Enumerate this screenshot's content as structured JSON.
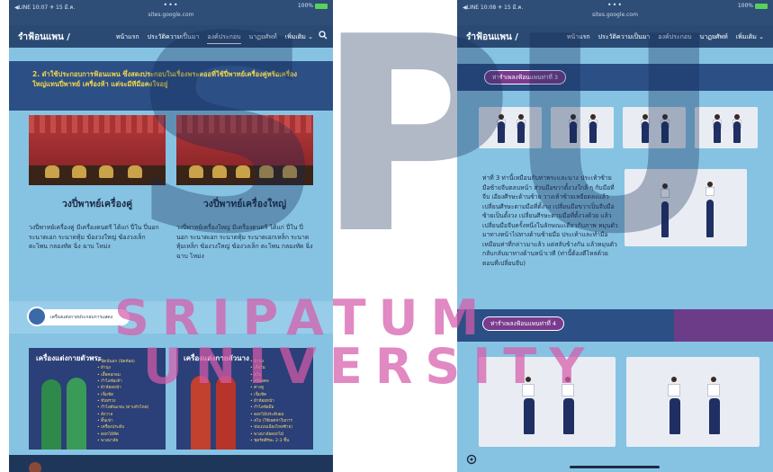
{
  "left": {
    "status": {
      "time": "◀LINE 10:07 ✈ 15 มี.ค.",
      "dots": "•••",
      "url": "sites.google.com",
      "battery": "100%"
    },
    "nav": {
      "site_title": "รำฟ้อนแพน /",
      "items": [
        "หน้าแรก",
        "ประวัติความเป็นมา",
        "องค์ประกอบ",
        "นาฏยศัพท์",
        "เพิ่มเติม ⌄"
      ],
      "active_index": 2
    },
    "section_text": "2. ดำใช้ประกอบการฟ้อนแพน ซึ่งสดงประกอบในเรื่องพระลออที่ใช้ปี่พาทย์เครื่องคู่หรือเครื่องใหญ่แทนปี่พาทย์ เครื่องห้า แต่จะมีทีมือคงใจอยู่",
    "ensembles": [
      {
        "title": "วงปี่พาทย์เครื่องคู่",
        "desc": "วงปี่พาทย์เครื่องคู่ มีเครื่องดนตรี ได้แก่ ปี่ใน ปี่นอก ระนาดเอก ระนาดทุ้ม ฆ้องวงใหญ่ ฆ้องวงเล็ก ตะโพน กลองทัด ฉิ่ง ฉาบ โหม่ง"
      },
      {
        "title": "วงปี่พาทย์เครื่องใหญ่",
        "desc": "วงปี่พาทย์เครื่องใหญ่ มีเครื่องดนตรี ได้แก่ ปี่ใน ปี่นอก ระนาดเอก ระนาดทุ้ม ระนาดเอกเหล็ก ระนาดทุ้มเหล็ก ฆ้องวงใหญ่ ฆ้องวงเล็ก ตะโพน กลองทัด ฉิ่ง ฉาบ โหม่ง"
      }
    ],
    "pill_text": "เครื่องแต่งกายประกอบการแสดง",
    "costumes": [
      {
        "title": "เครื่องแต่งกายตัวพระ",
        "items": [
          "นัดน์นอก (นัดห้อย)",
          "ผ้านุ่ง",
          "เสื้อคอกลม",
          "กำไลข้อเท้า",
          "ผ้าห้อยหน้า",
          "เข็มขัด",
          "ทับทรวง",
          "กำไลต้นแขน (ตาบหัวไหล่)",
          "สังวาล",
          "ดิ้นเข่า",
          "เครื่องประดับ",
          "ดอกไม้ทัด",
          "พวงมาลัย"
        ]
      },
      {
        "title": "เครื่องแต่งกายตัวนาง",
        "items": [
          "ผ้านุ่ง",
          "เสื้อใน",
          "สไบ",
          "สร้อยคอ",
          "ต่างหู",
          "เข็มขัด",
          "ผ้าห้อยหน้า",
          "กำไลข้อมือ",
          "ดอกไม้ประดับผม",
          "สไบ (ใช้เพศจ่าในการ",
          "ห่มแบบเฉียงไหล่ซ้าย)",
          "พวงมาลัยดอกไม้",
          "ชุดรัดศีรษะ 2-3 ชิ้น"
        ]
      }
    ]
  },
  "right": {
    "status": {
      "time": "◀LINE 10:08 ✈ 15 มี.ค.",
      "dots": "•••",
      "url": "sites.google.com",
      "battery": "100%"
    },
    "nav": {
      "site_title": "รำฟ้อนแพน /",
      "items": [
        "หน้าแรก",
        "ประวัติความเป็นมา",
        "องค์ประกอบ",
        "นาฏยศัพท์",
        "เพิ่มเติม ⌄"
      ]
    },
    "step3_label": "ท่ารำเพลงฟ้อนแพนท่าที่ 3",
    "step3_text": "ท่าที่ 3 ท่านี้เหมือนกับท่าพระและนาง ประเท้าซ้าย มือซ้ายจีบตลบหน้า ส่วนมือขวาตั้งวงใกล้ ๆ กับมือที่จีบ เอียงศีรษะด้านซ้าย วางเท้าซ้ายเหยียดลงแล้วเปลี่ยนศีรษะตามมือที่ตั้งวง เปลี่ยนมือขวาเป็นจีบมือซ้ายเป็นตั้งวง เปลี่ยนศีรษะตามมือที่ตั้งวงด้วย แล้วเปลี่ยนมือจีบครั้งหนึ่งในลักษณะเดียวกับภาพ หมุนตัวมาทางหน้าไปทางด้านซ้ายมือ ประเท้าและทำมือเหมือนท่าที่กล่าวมาแล้ว แต่สลับข้างกัน แล้วหมุนตัวกลับกลับมาทางด้านหน้าเวที (ท่านี้ต้องตีไหล่ด้วยตอนที่เปลี่ยนจีบ)",
    "step4_label": "ท่ารำเพลงฟ้อนแพนท่าที่ 4"
  },
  "watermark": {
    "big": "SPU",
    "line1": "SRIPATUM",
    "line2": "UNIVERSITY"
  },
  "colors": {
    "nav_bg": "#2a4a74",
    "page_bg": "#86c3e3",
    "accent_gold": "#f1d64c",
    "accent_purple": "#7a3b8f",
    "watermark_pink": "#d65caa"
  }
}
